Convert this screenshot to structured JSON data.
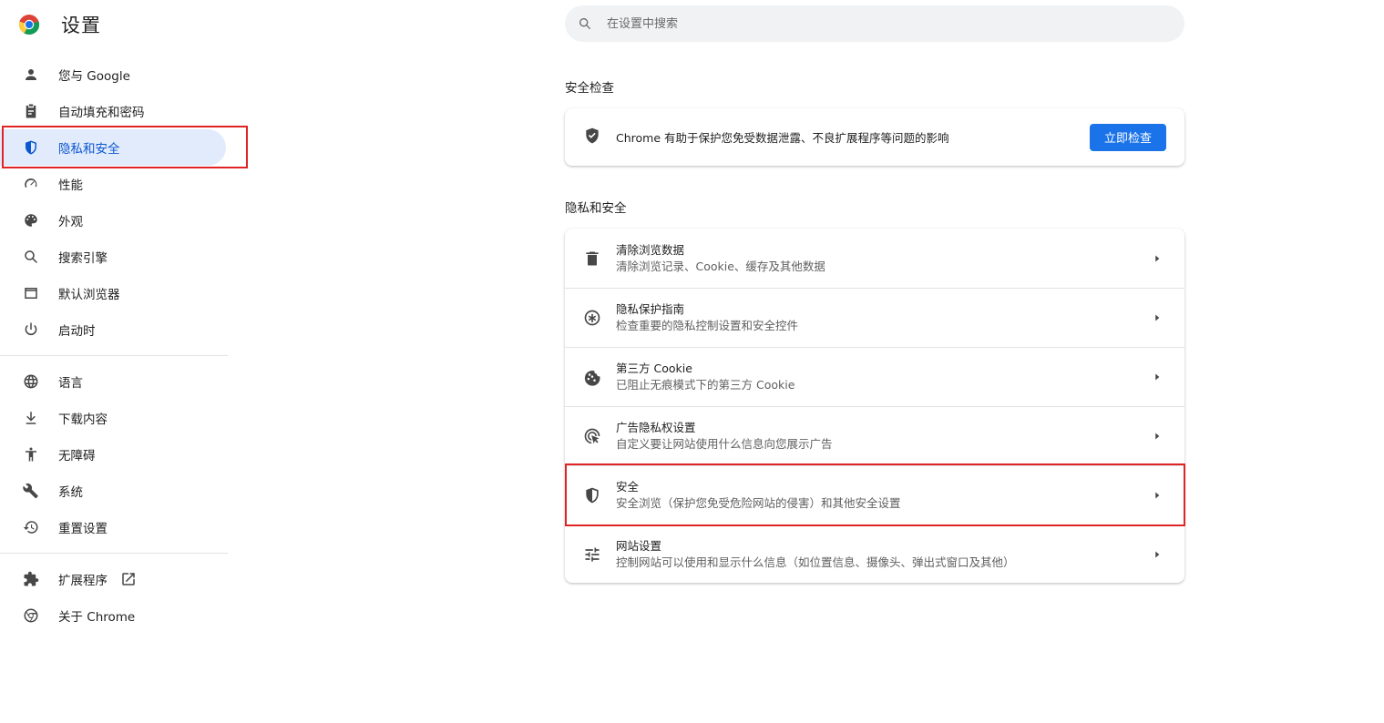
{
  "app": {
    "title": "设置"
  },
  "search": {
    "placeholder": "在设置中搜索"
  },
  "sidebar": {
    "items": [
      {
        "label": "您与 Google",
        "icon": "person-icon"
      },
      {
        "label": "自动填充和密码",
        "icon": "clipboard-icon"
      },
      {
        "label": "隐私和安全",
        "icon": "shield-icon",
        "active": true
      },
      {
        "label": "性能",
        "icon": "speedometer-icon"
      },
      {
        "label": "外观",
        "icon": "palette-icon"
      },
      {
        "label": "搜索引擎",
        "icon": "search-icon"
      },
      {
        "label": "默认浏览器",
        "icon": "browser-window-icon"
      },
      {
        "label": "启动时",
        "icon": "power-icon"
      },
      {
        "label": "语言",
        "icon": "globe-icon"
      },
      {
        "label": "下载内容",
        "icon": "download-icon"
      },
      {
        "label": "无障碍",
        "icon": "accessibility-icon"
      },
      {
        "label": "系统",
        "icon": "wrench-icon"
      },
      {
        "label": "重置设置",
        "icon": "restore-icon"
      },
      {
        "label": "扩展程序",
        "icon": "puzzle-icon"
      },
      {
        "label": "关于 Chrome",
        "icon": "chrome-icon"
      }
    ]
  },
  "safety_check": {
    "title": "安全检查",
    "text": "Chrome 有助于保护您免受数据泄露、不良扩展程序等问题的影响",
    "button": "立即检查"
  },
  "privacy": {
    "title": "隐私和安全",
    "rows": [
      {
        "title": "清除浏览数据",
        "subtitle": "清除浏览记录、Cookie、缓存及其他数据",
        "icon": "trash-icon"
      },
      {
        "title": "隐私保护指南",
        "subtitle": "检查重要的隐私控制设置和安全控件",
        "icon": "privacy-guide-icon"
      },
      {
        "title": "第三方 Cookie",
        "subtitle": "已阻止无痕模式下的第三方 Cookie",
        "icon": "cookie-icon"
      },
      {
        "title": "广告隐私权设置",
        "subtitle": "自定义要让网站使用什么信息向您展示广告",
        "icon": "ad-privacy-icon"
      },
      {
        "title": "安全",
        "subtitle": "安全浏览（保护您免受危险网站的侵害）和其他安全设置",
        "icon": "security-shield-icon"
      },
      {
        "title": "网站设置",
        "subtitle": "控制网站可以使用和显示什么信息（如位置信息、摄像头、弹出式窗口及其他）",
        "icon": "tune-icon"
      }
    ]
  },
  "colors": {
    "accent": "#0b57d0",
    "active_bg": "#e2ebfc",
    "button": "#1a73e8",
    "highlight": "#e02424"
  }
}
